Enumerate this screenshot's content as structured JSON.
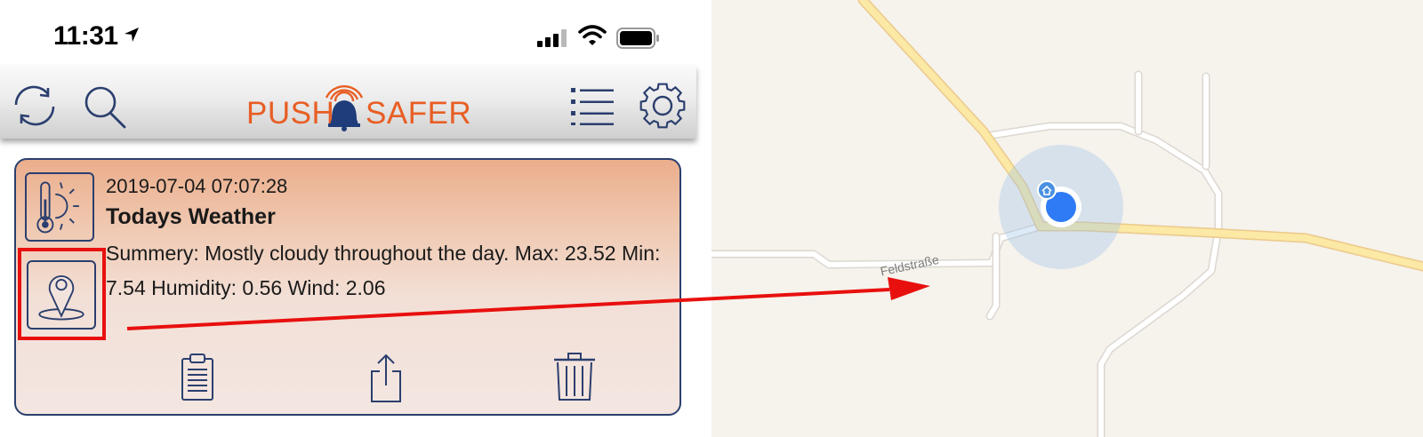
{
  "status_bar": {
    "time": "11:31"
  },
  "toolbar": {
    "logo_left": "PUSH",
    "logo_right": "SAFER",
    "icons": [
      "refresh-icon",
      "search-icon",
      "list-icon",
      "gear-icon"
    ]
  },
  "notification": {
    "date": "2019-07-04 07:07:28",
    "title": "Todays Weather",
    "message": "Summery: Mostly cloudy throughout the day. Max: 23.52 Min: 7.54 Humidity: 0.56 Wind: 2.06",
    "icons": [
      "weather-icon",
      "location-pin-icon"
    ],
    "actions": [
      "clipboard-icon",
      "share-icon",
      "trash-icon"
    ]
  },
  "map": {
    "street_label": "Feldstraße"
  },
  "colors": {
    "brand_orange": "#e85e24",
    "brand_navy": "#2b3f6e",
    "highlight_red": "#e8100e",
    "location_blue": "#2f7bf5"
  }
}
